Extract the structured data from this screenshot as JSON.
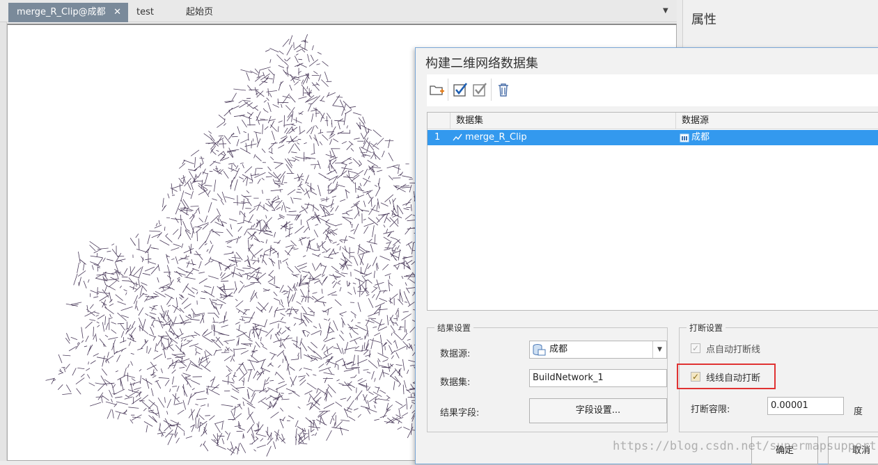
{
  "tabs": [
    {
      "label": "merge_R_Clip@成都",
      "active": true,
      "close": "✕"
    },
    {
      "label": "test",
      "active": false
    },
    {
      "label": "起始页",
      "active": false
    }
  ],
  "tab_dropdown": "▼",
  "properties_panel": {
    "title": "属性"
  },
  "dialog": {
    "title": "构建二维网络数据集",
    "toolbar": [
      "add-dataset",
      "select-all",
      "select-invert",
      "delete"
    ],
    "grid": {
      "columns": [
        "数据集",
        "数据源"
      ],
      "rows": [
        {
          "index": "1",
          "dataset": "merge_R_Clip",
          "datasource": "成都"
        }
      ]
    },
    "result_settings": {
      "title": "结果设置",
      "datasource_label": "数据源:",
      "datasource_value": "成都",
      "dataset_label": "数据集:",
      "dataset_value": "BuildNetwork_1",
      "field_label": "结果字段:",
      "field_button": "字段设置..."
    },
    "break_settings": {
      "title": "打断设置",
      "point_break_label": "点自动打断线",
      "point_break_checked": true,
      "line_break_label": "线线自动打断",
      "line_break_checked": true,
      "tolerance_label": "打断容限:",
      "tolerance_value": "0.00001",
      "tolerance_unit": "度"
    },
    "ok_button": "确定",
    "cancel_button": "取消"
  },
  "watermark": "https://blog.csdn.net/supermapsupport",
  "colors": {
    "map_lines": "#4a3a5a",
    "selection": "#3399ee",
    "highlight": "#e03232"
  }
}
